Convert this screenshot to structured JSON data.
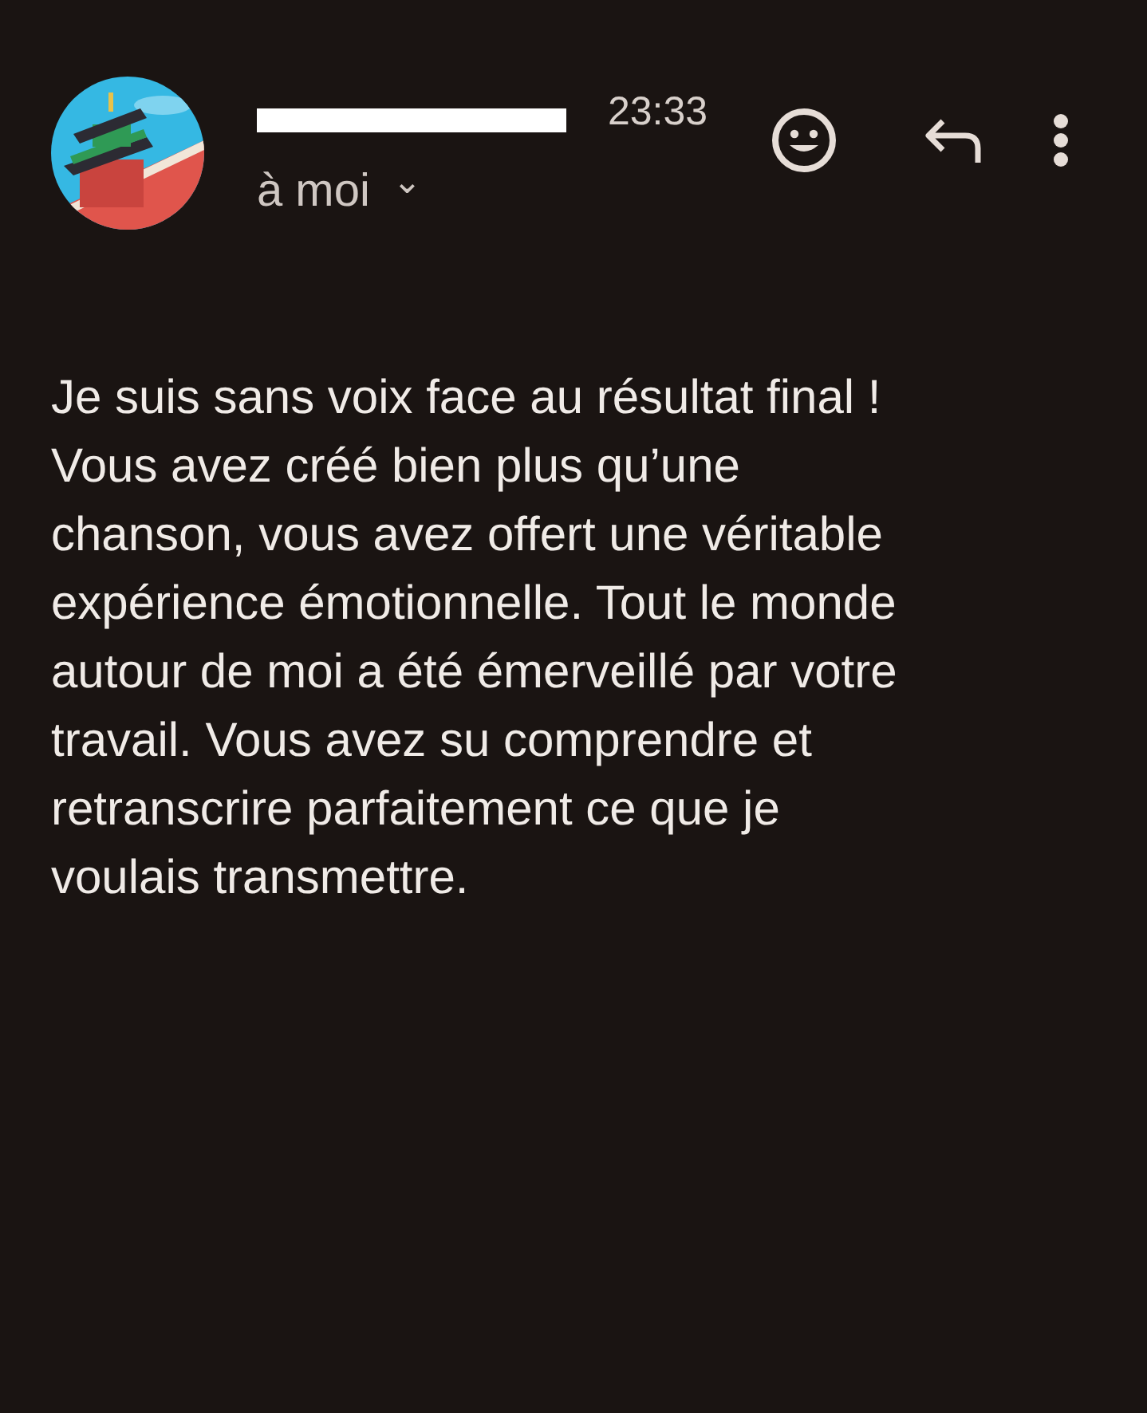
{
  "header": {
    "time": "23:33",
    "recipient": "à moi",
    "recipient_caret": "⌄"
  },
  "body": "Je suis sans voix face au résultat final !\nVous avez créé bien plus qu’une\nchanson, vous avez offert une véritable\nexpérience émotionnelle. Tout le monde\nautour de moi a été émerveillé par votre\ntravail. Vous avez su comprendre et\nretranscrire parfaitement ce que je\nvoulais transmettre."
}
